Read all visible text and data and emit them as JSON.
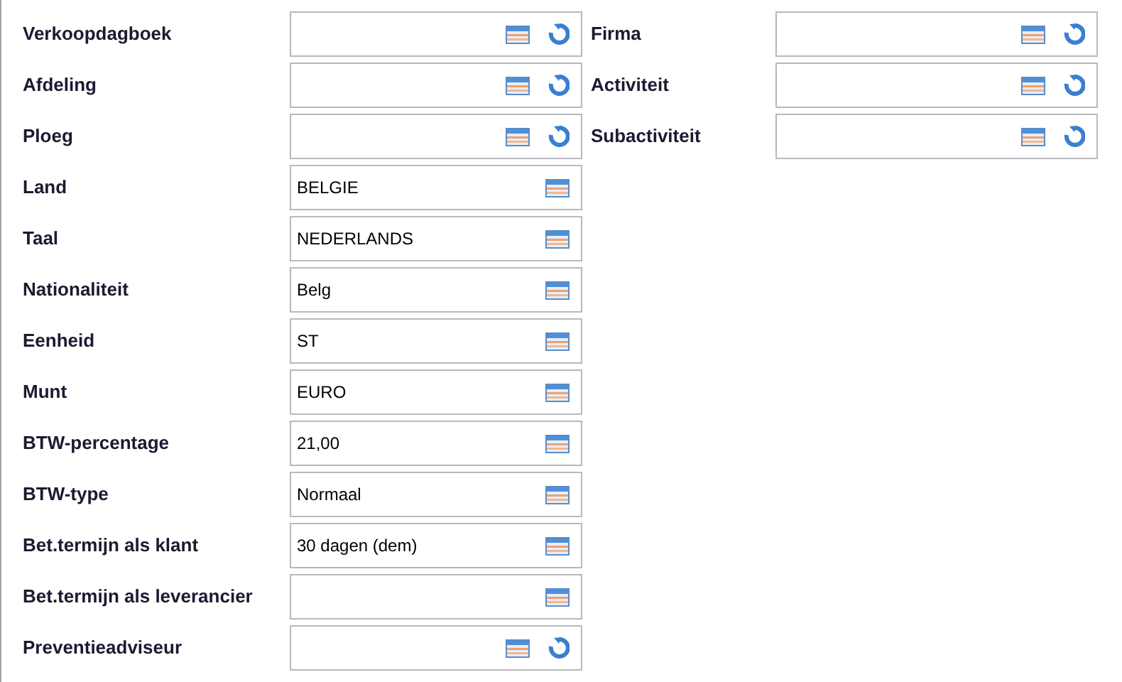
{
  "left": [
    {
      "label": "Verkoopdagboek",
      "reset": true
    },
    {
      "label": "Afdeling",
      "reset": true
    },
    {
      "label": "Ploeg",
      "reset": true
    },
    {
      "label": "Land",
      "value": "BELGIE",
      "reset": false
    },
    {
      "label": "Taal",
      "value": "NEDERLANDS",
      "reset": false
    },
    {
      "label": "Nationaliteit",
      "value": "Belg",
      "reset": false
    },
    {
      "label": "Eenheid",
      "value": "ST",
      "reset": false
    },
    {
      "label": "Munt",
      "value": "EURO",
      "reset": false
    },
    {
      "label": "BTW-percentage",
      "value": "21,00",
      "reset": false
    },
    {
      "label": "BTW-type",
      "value": "Normaal",
      "reset": false
    },
    {
      "label": "Bet.termijn als klant",
      "value": "30 dagen (dem)",
      "reset": false
    },
    {
      "label": "Bet.termijn als leverancier",
      "reset": false
    },
    {
      "label": "Preventieadviseur",
      "reset": true
    }
  ],
  "right": [
    {
      "label": "Firma",
      "reset": true
    },
    {
      "label": "Activiteit",
      "reset": true
    },
    {
      "label": "Subactiviteit",
      "reset": true
    }
  ]
}
